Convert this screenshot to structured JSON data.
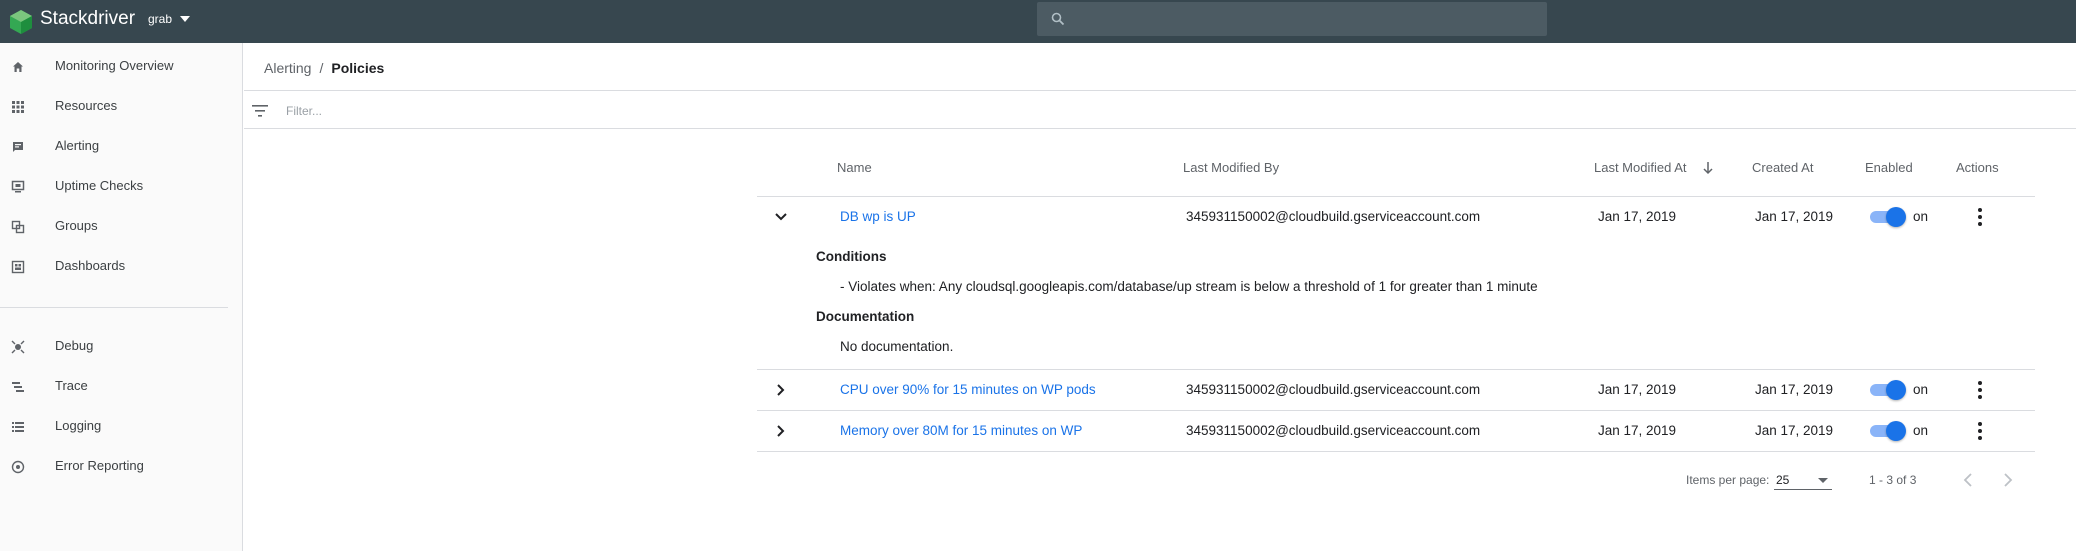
{
  "topbar": {
    "title": "Stackdriver",
    "project": "grab",
    "search": {
      "placeholder": "",
      "value": ""
    },
    "bg_color": "#37474f"
  },
  "sidebar": {
    "items": [
      {
        "label": "Monitoring Overview",
        "icon": "home-icon"
      },
      {
        "label": "Resources",
        "icon": "grid-icon"
      },
      {
        "label": "Alerting",
        "icon": "alert-message-icon"
      },
      {
        "label": "Uptime Checks",
        "icon": "monitor-check-icon"
      },
      {
        "label": "Groups",
        "icon": "groups-icon"
      },
      {
        "label": "Dashboards",
        "icon": "dashboard-icon"
      },
      {
        "label": "Debug",
        "icon": "debug-icon"
      },
      {
        "label": "Trace",
        "icon": "trace-icon"
      },
      {
        "label": "Logging",
        "icon": "logging-icon"
      },
      {
        "label": "Error Reporting",
        "icon": "error-reporting-icon"
      }
    ]
  },
  "breadcrumb": {
    "parent": "Alerting",
    "separator": "/",
    "current": "Policies"
  },
  "filter": {
    "placeholder": "Filter...",
    "value": ""
  },
  "table": {
    "columns": {
      "name": "Name",
      "modified_by": "Last Modified By",
      "modified_at": "Last Modified At",
      "created_at": "Created At",
      "enabled": "Enabled",
      "actions": "Actions"
    },
    "sort": {
      "column": "Last Modified At",
      "direction": "descending"
    },
    "rows": [
      {
        "name": "DB wp is UP",
        "modified_by": "345931150002@cloudbuild.gserviceaccount.com",
        "modified_at": "Jan 17, 2019",
        "created_at": "Jan 17, 2019",
        "enabled": "on",
        "expanded": true
      },
      {
        "name": "CPU over 90% for 15 minutes on WP pods",
        "modified_by": "345931150002@cloudbuild.gserviceaccount.com",
        "modified_at": "Jan 17, 2019",
        "created_at": "Jan 17, 2019",
        "enabled": "on",
        "expanded": false
      },
      {
        "name": "Memory over 80M for 15 minutes on WP",
        "modified_by": "345931150002@cloudbuild.gserviceaccount.com",
        "modified_at": "Jan 17, 2019",
        "created_at": "Jan 17, 2019",
        "enabled": "on",
        "expanded": false
      }
    ],
    "detail": {
      "conditions_heading": "Conditions",
      "condition_text": "- Violates when: Any cloudsql.googleapis.com/database/up stream is below a threshold of 1 for greater than 1 minute",
      "documentation_heading": "Documentation",
      "documentation_text": "No documentation."
    }
  },
  "paginator": {
    "items_per_page_label": "Items per page:",
    "items_per_page": "25",
    "range": "1 - 3 of 3"
  },
  "colors": {
    "link": "#1a73e8",
    "toggle_on": "#1a73e8",
    "toggle_track": "#8ab4f8"
  }
}
